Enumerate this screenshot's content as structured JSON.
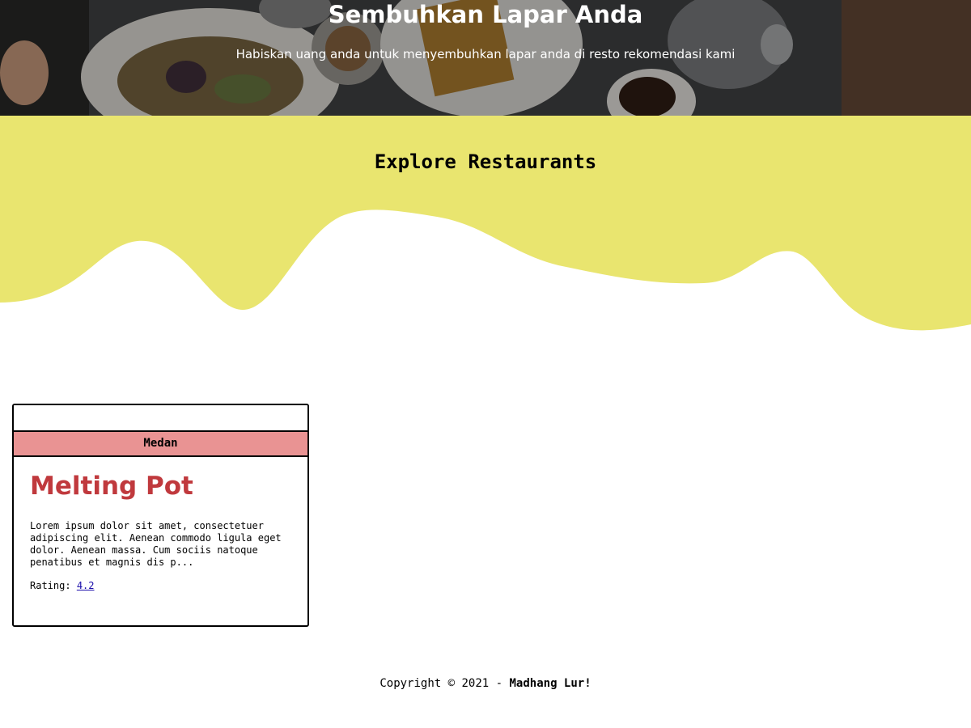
{
  "hero": {
    "title": "Sembuhkan Lapar Anda",
    "subtitle": "Habiskan uang anda untuk menyembuhkan lapar anda di resto rekomendasi kami"
  },
  "explore": {
    "title": "Explore Restaurants"
  },
  "restaurants": [
    {
      "city": "Medan",
      "name": "Melting Pot",
      "description": "Lorem ipsum dolor sit amet, consectetuer adipiscing elit. Aenean commodo ligula eget dolor. Aenean massa. Cum sociis natoque penatibus et magnis dis p...",
      "rating_label": "Rating:",
      "rating": "4.2"
    }
  ],
  "footer": {
    "prefix": "Copyright © 2021 - ",
    "brand": "Madhang Lur!"
  },
  "colors": {
    "wave_yellow": "#e9e56f",
    "city_badge": "#e99393",
    "restaurant_name": "#c0393d"
  }
}
